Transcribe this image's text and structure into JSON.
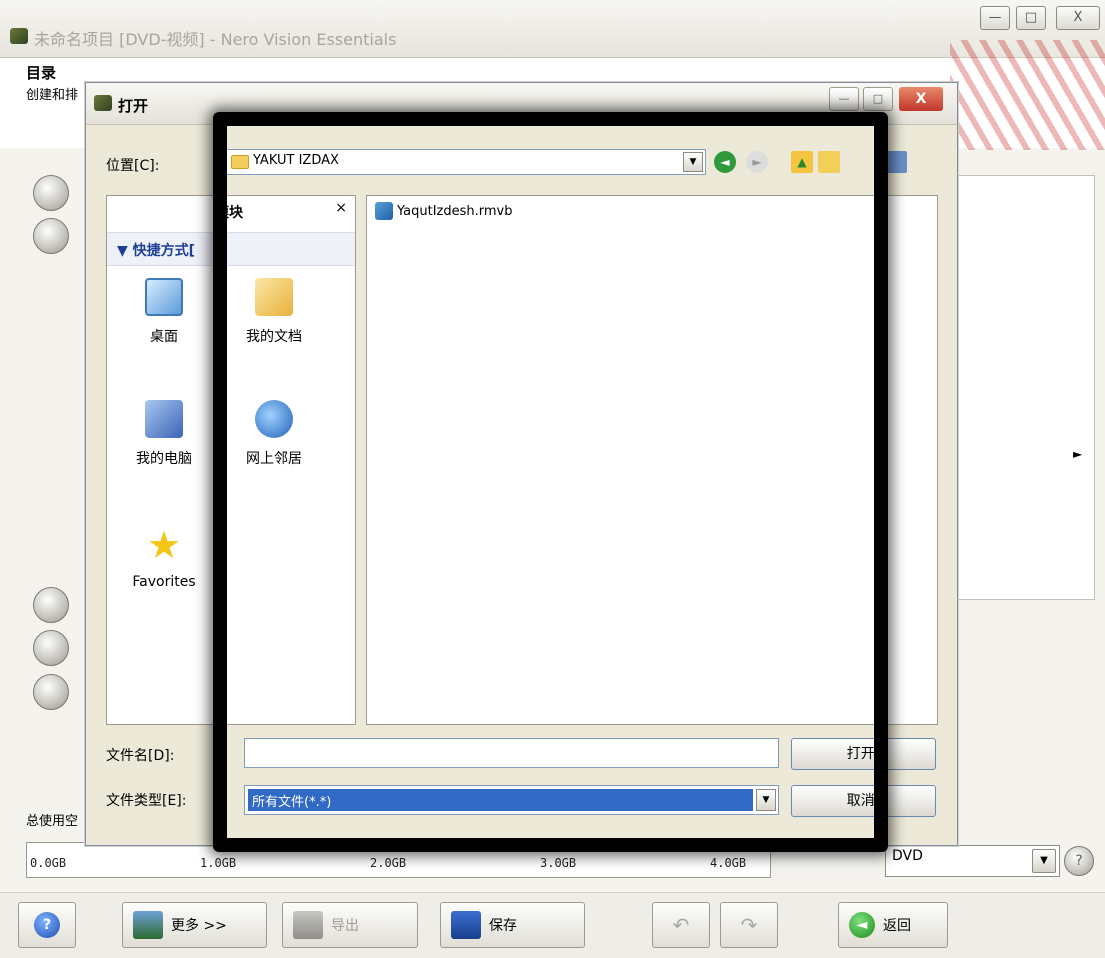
{
  "app": {
    "title": "未命名项目 [DVD-视频] - Nero Vision Essentials",
    "controls": {
      "minimize": "—",
      "maximize": "□",
      "close": "X"
    }
  },
  "header": {
    "title": "目录",
    "subtitle": "创建和排"
  },
  "dialog": {
    "title": "打开",
    "close": "X",
    "look_in_label": "位置[C]:",
    "look_in_value": "YAKUT IZDAX",
    "places_title": "模块",
    "places_close": "×",
    "quick_header": "▼ 快捷方式[",
    "places": [
      {
        "label": "桌面",
        "icon": "desktop-icon"
      },
      {
        "label": "我的文档",
        "icon": "my-documents-icon"
      },
      {
        "label": "我的电脑",
        "icon": "my-computer-icon"
      },
      {
        "label": "网上邻居",
        "icon": "network-icon"
      },
      {
        "label": "Favorites",
        "icon": "star-icon"
      }
    ],
    "files": [
      {
        "name": "YaqutIzdesh.rmvb",
        "icon": "video-file-icon"
      }
    ],
    "filename_label": "文件名[D]:",
    "filename_value": "",
    "filetype_label": "文件类型[E]:",
    "filetype_value": "所有文件(*.*)",
    "open_button": "打开[",
    "cancel_button": "取消["
  },
  "capacity": {
    "label": "总使用空",
    "ticks": [
      "0.0GB",
      "1.0GB",
      "2.0GB",
      "3.0GB",
      "4.0GB"
    ],
    "disc_type": "DVD"
  },
  "toolbar": {
    "more": "更多 >>",
    "export": "导出",
    "save": "保存",
    "back": "返回"
  }
}
